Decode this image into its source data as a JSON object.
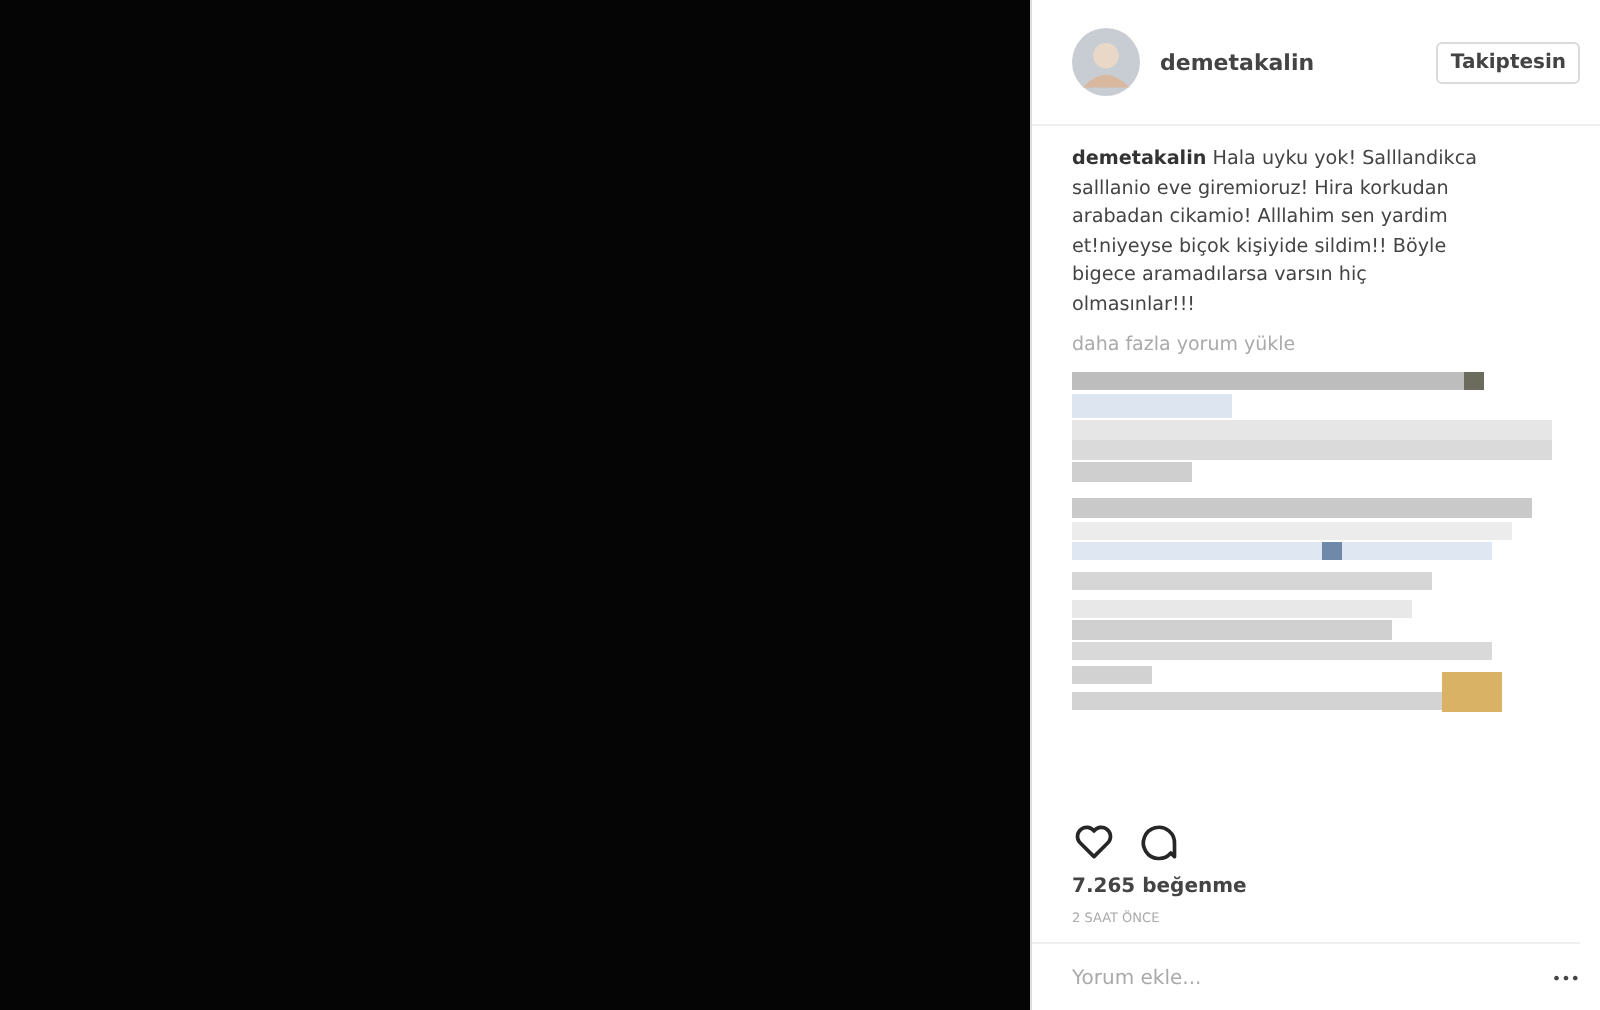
{
  "post": {
    "username": "demetakalin",
    "follow_button": "Takiptesin",
    "caption": "**demetakalin** Hala uyku yok! Salllandikca salllanio eve giremioruz! Hira korkudan arabadan cikamio! Alllahim sen yardim et!niyeyse biçok kişiyide sildim!! Böyle bigece aramadılarsa varsın hiç olmasınlar!!!",
    "load_more": "daha fazla yorum yükle",
    "likes": "7.265 beğenme",
    "time": "2 SAAT ÖNCE",
    "comment_field": {
      "placeholder": "Yorum ekle..."
    },
    "more_button": "•••"
  }
}
